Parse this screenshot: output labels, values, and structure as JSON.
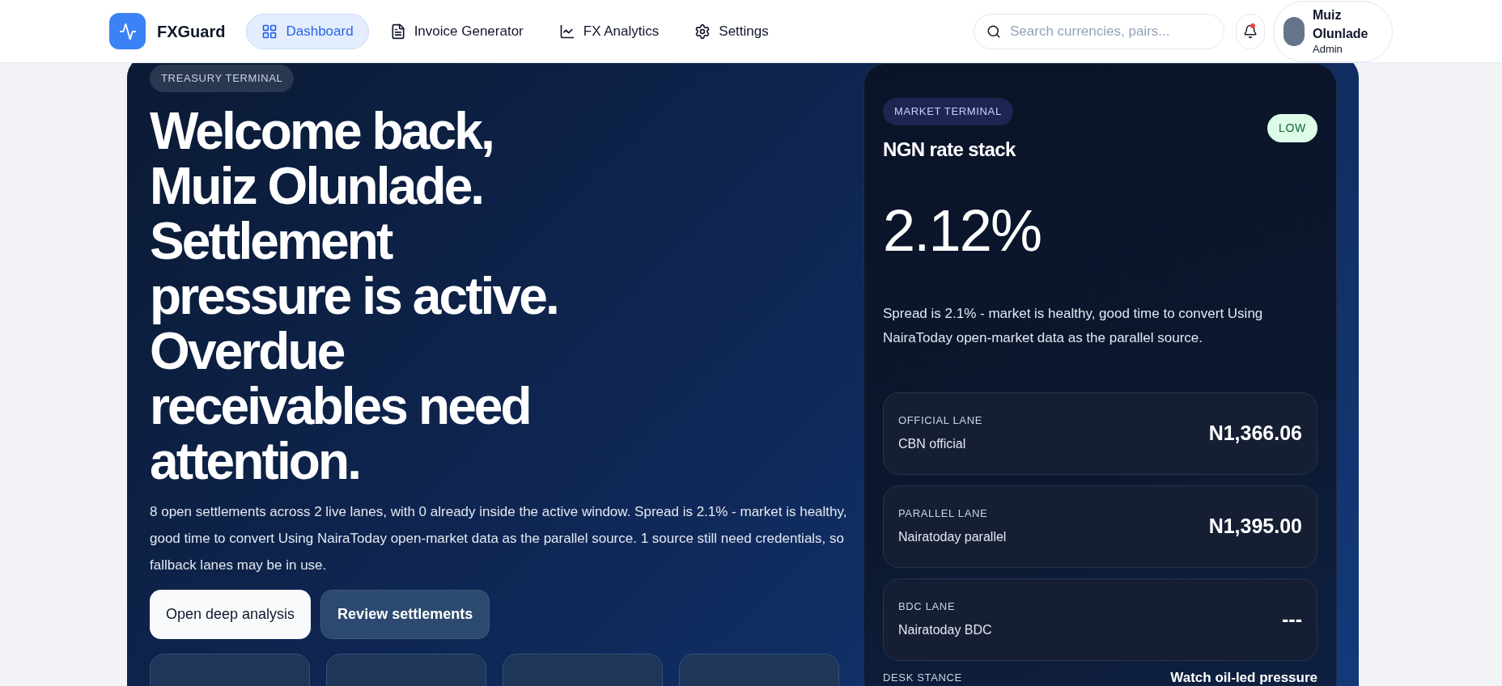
{
  "brand": {
    "name": "FXGuard"
  },
  "nav": [
    {
      "label": "Dashboard",
      "selected": true
    },
    {
      "label": "Invoice Generator",
      "selected": false
    },
    {
      "label": "FX Analytics",
      "selected": false
    },
    {
      "label": "Settings",
      "selected": false
    }
  ],
  "search": {
    "placeholder": "Search currencies, pairs..."
  },
  "notifications": {
    "unread": true
  },
  "user": {
    "name": "Muiz Olunlade",
    "role": "Admin"
  },
  "hero": {
    "badge": "TREASURY TERMINAL",
    "heading": "Welcome back, Muiz Olunlade. Settlement pressure is active. Overdue receivables need attention.",
    "summary": "8 open settlements across 2 live lanes, with 0 already inside the active window. Spread is 2.1% - market is healthy, good time to convert Using NairaToday open-market data as the parallel source. 1 source still need credentials, so fallback lanes may be in use.",
    "buttons": [
      {
        "label": "Open deep analysis",
        "kind": "primary"
      },
      {
        "label": "Review settlements",
        "kind": "secondary"
      }
    ]
  },
  "market": {
    "badge": "MARKET TERMINAL",
    "title": "NGN rate stack",
    "risk": {
      "label": "LOW",
      "color": "#dcfce7"
    },
    "spread": "2.12%",
    "note": "Spread is 2.1% - market is healthy, good time to convert Using NairaToday open-market data as the parallel source.",
    "lanes": [
      {
        "label": "OFFICIAL LANE",
        "source": "CBN official",
        "rate": "N1,366.06"
      },
      {
        "label": "PARALLEL LANE",
        "source": "Nairatoday parallel",
        "rate": "N1,395.00"
      },
      {
        "label": "BDC LANE",
        "source": "Nairatoday BDC",
        "rate": "---"
      }
    ],
    "stance": {
      "label": "DESK STANCE",
      "value": "Watch oil-led pressure"
    }
  }
}
